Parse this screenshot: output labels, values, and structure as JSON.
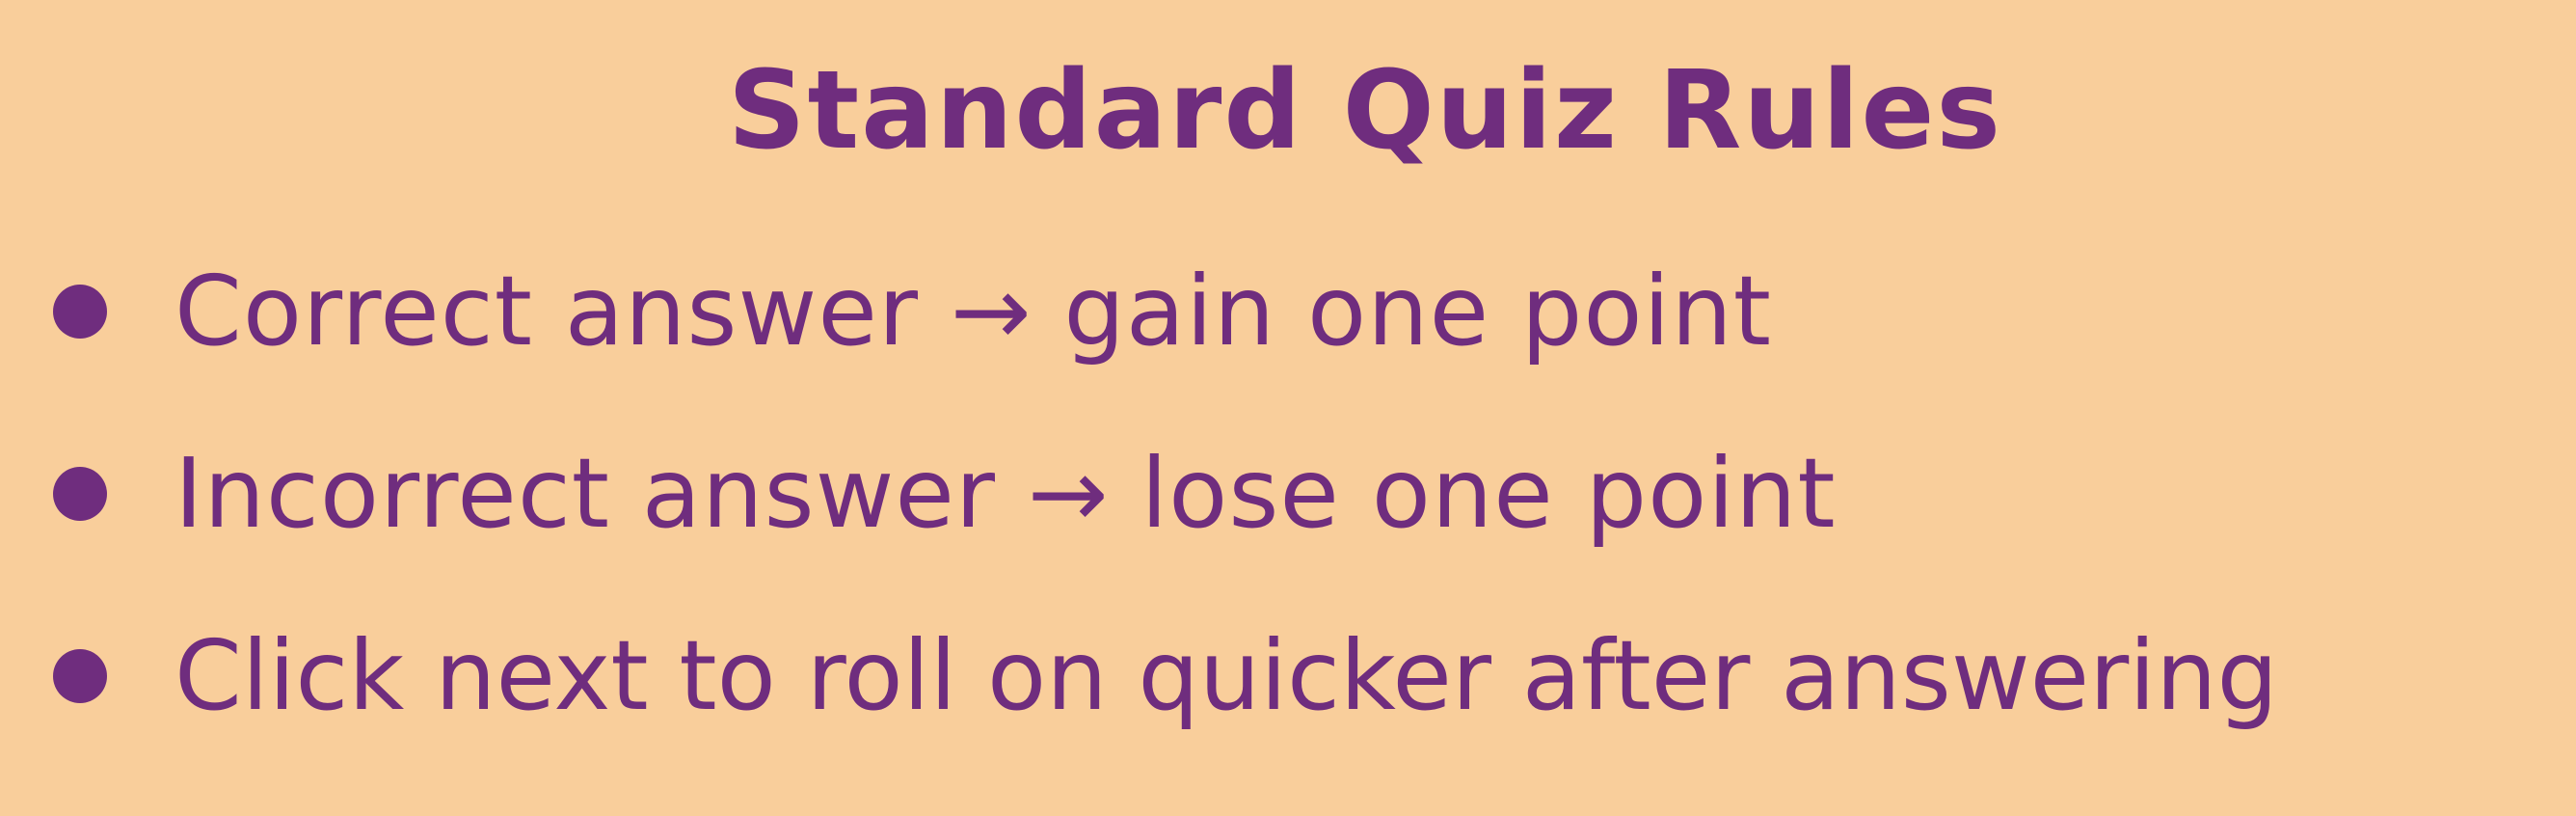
{
  "title": "Standard Quiz Rules",
  "rules": [
    {
      "text": "Correct answer → gain one point",
      "icon": "bullet-dot"
    },
    {
      "text": "Incorrect answer → lose one point",
      "icon": "bullet-dot"
    },
    {
      "text": "Click next to roll on quicker after answering",
      "icon": "bullet-dot"
    }
  ],
  "colors": {
    "background": "#F9CE9B",
    "text": "#6F2D7E"
  }
}
